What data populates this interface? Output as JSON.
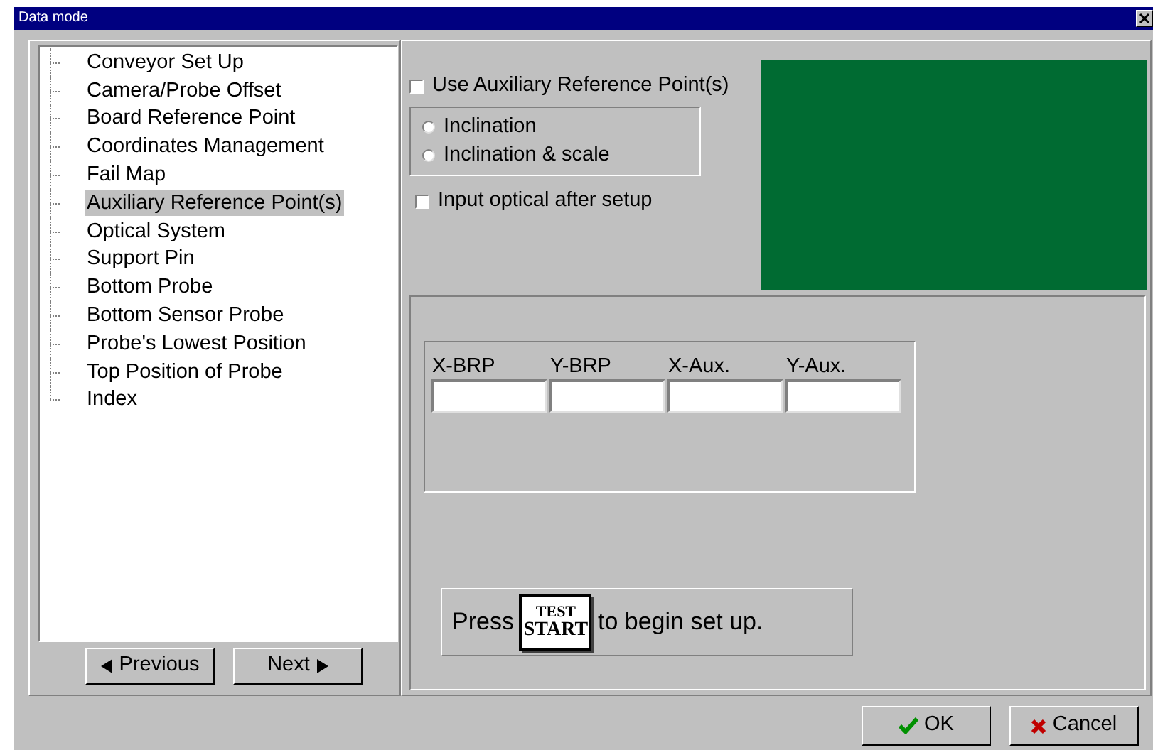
{
  "window": {
    "title": "Data mode"
  },
  "tree": {
    "items": [
      {
        "label": "Conveyor Set Up",
        "selected": false
      },
      {
        "label": "Camera/Probe Offset",
        "selected": false
      },
      {
        "label": "Board Reference Point",
        "selected": false
      },
      {
        "label": "Coordinates Management",
        "selected": false
      },
      {
        "label": "Fail Map",
        "selected": false
      },
      {
        "label": "Auxiliary Reference Point(s)",
        "selected": true
      },
      {
        "label": "Optical System",
        "selected": false
      },
      {
        "label": "Support Pin",
        "selected": false
      },
      {
        "label": "Bottom Probe",
        "selected": false
      },
      {
        "label": "Bottom Sensor Probe",
        "selected": false
      },
      {
        "label": "Probe's Lowest Position",
        "selected": false
      },
      {
        "label": "Top Position of Probe",
        "selected": false
      },
      {
        "label": "Index",
        "selected": false
      }
    ]
  },
  "nav_buttons": [
    {
      "label": "Previous",
      "kind": "previous"
    },
    {
      "label": "Next",
      "kind": "next"
    }
  ],
  "use_auxiliary": {
    "label": "Use Auxiliary Reference Point(s)",
    "checked": false
  },
  "mode_options": [
    {
      "label": "Inclination",
      "selected": false
    },
    {
      "label": "Inclination & scale",
      "selected": false
    }
  ],
  "input_optical": {
    "label": "Input optical after setup",
    "checked": false
  },
  "coordinates": [
    {
      "label": "X-BRP"
    },
    {
      "label": "Y-BRP"
    },
    {
      "label": "X-Aux."
    },
    {
      "label": "Y-Aux."
    }
  ],
  "instruction": {
    "before": "Press",
    "key_top": "TEST",
    "key_bottom": "START",
    "after": "to begin set up."
  },
  "buttons": [
    {
      "label": "OK",
      "kind": "ok"
    },
    {
      "label": "Cancel",
      "kind": "cancel"
    }
  ]
}
